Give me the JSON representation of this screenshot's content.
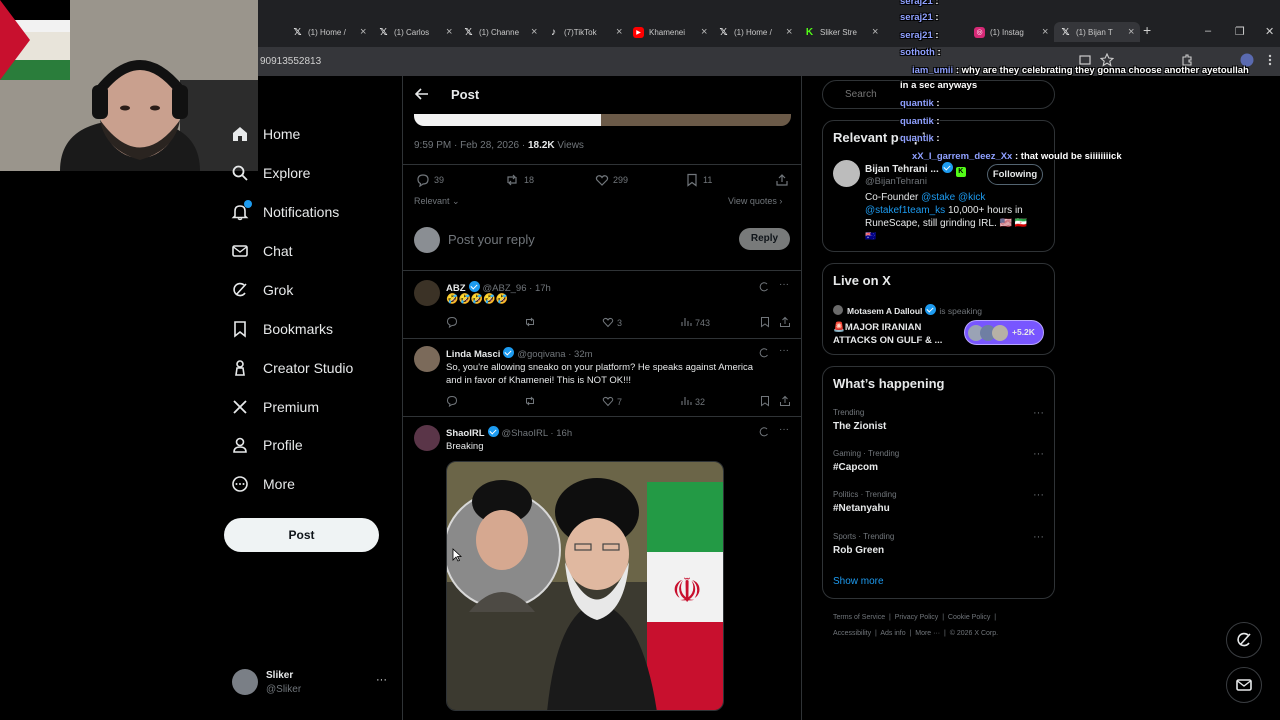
{
  "browser": {
    "tabs": [
      {
        "label": "(1) Home /",
        "icon": "x-logo-icon"
      },
      {
        "label": "(1) Carlos",
        "icon": "x-logo-icon"
      },
      {
        "label": "(1) Channe",
        "icon": "x-logo-icon"
      },
      {
        "label": "(7)TikTok",
        "icon": "tiktok-icon"
      },
      {
        "label": "Khamenei",
        "icon": "youtube-icon"
      },
      {
        "label": "(1) Home /",
        "icon": "x-logo-icon"
      },
      {
        "label": "Sliker Stre",
        "icon": "kick-icon"
      },
      {
        "label": "(1) Instag",
        "icon": "instagram-icon"
      },
      {
        "label": "(1) Bijan T",
        "icon": "x-logo-icon"
      }
    ],
    "url": "90913552813"
  },
  "nav": {
    "items": [
      {
        "label": "Home",
        "icon": "home-icon"
      },
      {
        "label": "Explore",
        "icon": "search-icon"
      },
      {
        "label": "Notifications",
        "icon": "bell-icon"
      },
      {
        "label": "Chat",
        "icon": "mail-icon"
      },
      {
        "label": "Grok",
        "icon": "grok-icon"
      },
      {
        "label": "Bookmarks",
        "icon": "bookmark-icon"
      },
      {
        "label": "Creator Studio",
        "icon": "creator-studio-icon"
      },
      {
        "label": "Premium",
        "icon": "x-logo-icon"
      },
      {
        "label": "Profile",
        "icon": "person-icon"
      },
      {
        "label": "More",
        "icon": "more-circle-icon"
      }
    ],
    "post_button": "Post",
    "account": {
      "name": "Sliker",
      "handle": "@Sliker",
      "more": "···"
    }
  },
  "post": {
    "header_title": "Post",
    "timestamp": "9:59 PM · Feb 28, 2026 · ",
    "views_count": "18.2K",
    "views_label": " Views",
    "stats": {
      "replies": "39",
      "reposts": "18",
      "likes": "299",
      "bookmarks": "11"
    },
    "relevant_label": "Relevant",
    "view_quotes": "View quotes",
    "reply_placeholder": "Post your reply",
    "reply_button": "Reply"
  },
  "replies": [
    {
      "name": "ABZ",
      "handle": "@ABZ_96",
      "time": "17h",
      "text": "🤣🤣🤣🤣🤣",
      "reply_count": "",
      "repost_count": "",
      "likes": "3",
      "views": "743"
    },
    {
      "name": "Linda Masci",
      "handle": "@goqivana",
      "time": "32m",
      "text_line1": "So, you're allowing sneako on your platform?  He speaks against America",
      "text_line2": "and in favor of Khamenei!  This is NOT OK!!!",
      "likes": "7",
      "views": "32"
    },
    {
      "name": "ShaoIRL",
      "handle": "@ShaoIRL",
      "time": "16h",
      "text": "Breaking"
    }
  ],
  "sidebar": {
    "search_placeholder": "Search",
    "relevant_people_title": "Relevant people",
    "person": {
      "name": "Bijan Tehrani ...",
      "handle": "@BijanTehrani",
      "follow_button": "Following",
      "bio_line1_prefix": "Co-Founder ",
      "bio_mention1": "@stake",
      "bio_mention2": "@kick",
      "bio_mention3": "@stakef1team_ks",
      "bio_line2_suffix": " 10,000+ hours in",
      "bio_line3": "RuneScape, still grinding IRL. 🇺🇸 🇮🇷",
      "bio_line4": "🇦🇺"
    },
    "live_title": "Live on X",
    "live": {
      "host": "Motasem A Dalloul",
      "status": "is speaking",
      "title_line1": "🚨MAJOR IRANIAN",
      "title_line2": "ATTACKS ON GULF & ...",
      "listeners": "+5.2K"
    },
    "happening_title": "What’s happening",
    "trends": [
      {
        "category": "Trending",
        "name": "The Zionist"
      },
      {
        "category": "Gaming · Trending",
        "name": "#Capcom"
      },
      {
        "category": "Politics · Trending",
        "name": "#Netanyahu"
      },
      {
        "category": "Sports · Trending",
        "name": "Rob Green"
      }
    ],
    "show_more": "Show more",
    "footer_line1": [
      "Terms of Service",
      "Privacy Policy",
      "Cookie Policy"
    ],
    "footer_line2": [
      "Accessibility",
      "Ads info",
      "More ···",
      "© 2026 X Corp."
    ]
  },
  "chat": [
    {
      "user": "seraj21",
      "msg": ":"
    },
    {
      "user": "seraj21",
      "msg": ":"
    },
    {
      "user": "seraj21",
      "msg": ":"
    },
    {
      "user": "sothoth",
      "msg": ":"
    },
    {
      "user": "iam_umii",
      "msg": ": why are they celebrating they gonna choose another ayetoullah"
    },
    {
      "user": "",
      "msg": "in a sec anyways"
    },
    {
      "user": "quantik",
      "msg": ":"
    },
    {
      "user": "quantik",
      "msg": ":"
    },
    {
      "user": "quantik",
      "msg": ":"
    },
    {
      "user": "xX_I_garrem_deez_Xx",
      "msg": ": that would be siiiiiiiick"
    }
  ],
  "colors": {
    "accent": "#1d9bf0",
    "background": "#000000",
    "border": "#2f3336",
    "muted": "#71767b",
    "live_purple": "#7856ff"
  }
}
